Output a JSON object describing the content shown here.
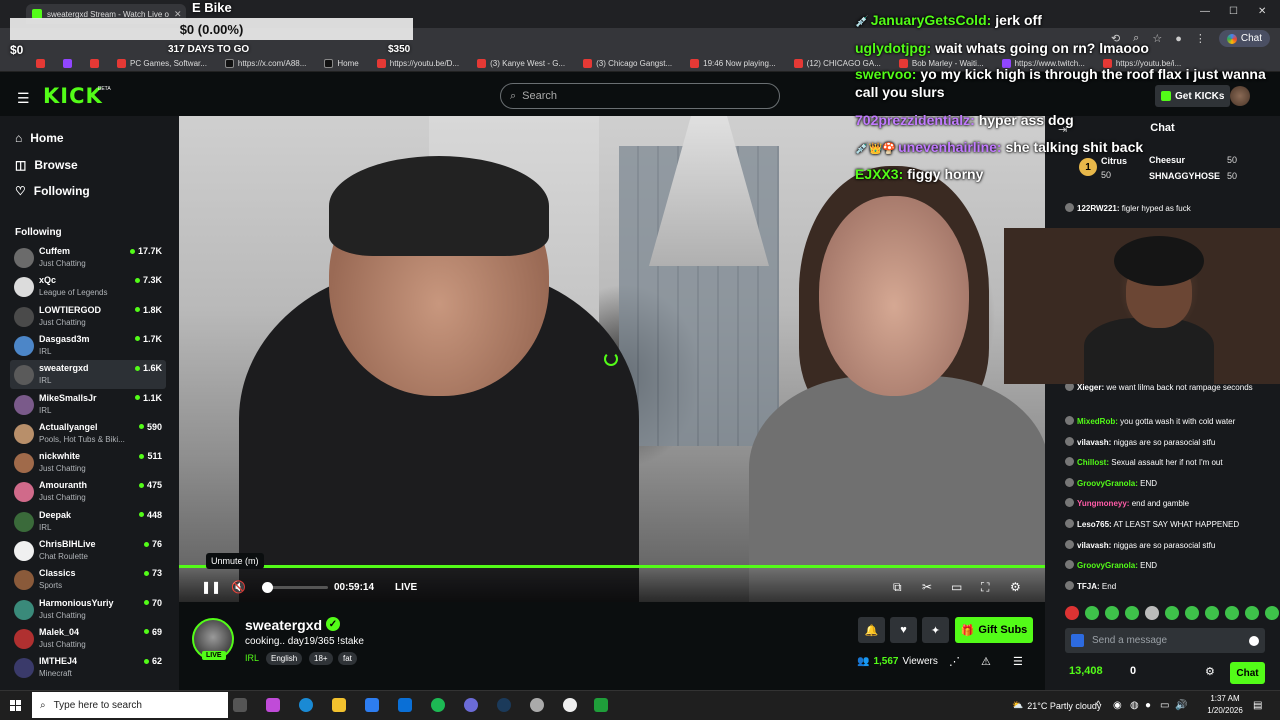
{
  "browser": {
    "tab_title": "sweatergxd Stream - Watch Live o",
    "tab_close": "✕",
    "win_min": "—",
    "win_max": "☐",
    "win_close": "✕",
    "chat_button": "Chat",
    "bookmarks": [
      {
        "label": "",
        "icon": "youtube"
      },
      {
        "label": "",
        "icon": "twitch"
      },
      {
        "label": "",
        "icon": "youtube"
      },
      {
        "label": "PC Games, Softwar...",
        "icon": "youtube"
      },
      {
        "label": "https://x.com/A88...",
        "icon": "x"
      },
      {
        "label": "Home",
        "icon": "x"
      },
      {
        "label": "https://youtu.be/D...",
        "icon": "youtube"
      },
      {
        "label": "(3) Kanye West - G...",
        "icon": "youtube"
      },
      {
        "label": "(3) Chicago Gangst...",
        "icon": "youtube"
      },
      {
        "label": "19:46 Now playing...",
        "icon": "youtube"
      },
      {
        "label": "(12) CHICAGO GA...",
        "icon": "youtube"
      },
      {
        "label": "Bob Marley - Waiti...",
        "icon": "youtube"
      },
      {
        "label": "https://www.twitch...",
        "icon": "twitch"
      },
      {
        "label": "https://youtu.be/i...",
        "icon": "youtube"
      }
    ]
  },
  "goal_overlay": {
    "title": "E Bike",
    "amount": "$0 (0.00%)",
    "min": "$0",
    "days": "317 DAYS TO GO",
    "max": "$350"
  },
  "header": {
    "logo": "KICK",
    "beta": "BETA",
    "search_placeholder": "Search",
    "get_kicks": "Get KICKs"
  },
  "nav": {
    "home": "Home",
    "browse": "Browse",
    "following": "Following",
    "following_header": "Following"
  },
  "channels": [
    {
      "name": "Cuffem",
      "category": "Just Chatting",
      "viewers": "17.7K",
      "color": "#6b6b6b"
    },
    {
      "name": "xQc",
      "category": "League of Legends",
      "viewers": "7.3K",
      "color": "#dcdcdc"
    },
    {
      "name": "LOWTIERGOD",
      "category": "Just Chatting",
      "viewers": "1.8K",
      "color": "#4a4a4a"
    },
    {
      "name": "Dasgasd3m",
      "category": "IRL",
      "viewers": "1.7K",
      "color": "#4c86c8"
    },
    {
      "name": "sweatergxd",
      "category": "IRL",
      "viewers": "1.6K",
      "color": "#5a5a5a"
    },
    {
      "name": "MikeSmallsJr",
      "category": "IRL",
      "viewers": "1.1K",
      "color": "#7a5a8a"
    },
    {
      "name": "Actuallyangel",
      "category": "Pools, Hot Tubs & Biki...",
      "viewers": "590",
      "color": "#b88f6a"
    },
    {
      "name": "nickwhite",
      "category": "Just Chatting",
      "viewers": "511",
      "color": "#a06a4a"
    },
    {
      "name": "Amouranth",
      "category": "Just Chatting",
      "viewers": "475",
      "color": "#d06a8a"
    },
    {
      "name": "Deepak",
      "category": "IRL",
      "viewers": "448",
      "color": "#3a6a3a"
    },
    {
      "name": "ChrisBIHLive",
      "category": "Chat Roulette",
      "viewers": "76",
      "color": "#f0f0f0"
    },
    {
      "name": "Classics",
      "category": "Sports",
      "viewers": "73",
      "color": "#8a5a3a"
    },
    {
      "name": "HarmoniousYuriy",
      "category": "Just Chatting",
      "viewers": "70",
      "color": "#3a8a7a"
    },
    {
      "name": "Malek_04",
      "category": "Just Chatting",
      "viewers": "69",
      "color": "#b03030"
    },
    {
      "name": "IMTHEJ4",
      "category": "Minecraft",
      "viewers": "62",
      "color": "#3a3a6a"
    }
  ],
  "player": {
    "tooltip": "Unmute (m)",
    "time": "00:59:14",
    "live": "LIVE",
    "progress_fraction": 1.0,
    "volume_fraction": 0.0
  },
  "stream": {
    "streamer": "sweatergxd",
    "live_badge": "LIVE",
    "title": "cooking.. day19/365 !stake",
    "category": "IRL",
    "tags": [
      "English",
      "18+",
      "fat"
    ],
    "gift_subs": "Gift Subs",
    "viewers_count": "1,567",
    "viewers_label": "Viewers"
  },
  "chat": {
    "header": "Chat",
    "leaderboard": [
      {
        "name": "Citrus",
        "value": "50",
        "color": "#e8b84a"
      },
      {
        "name": "Cheesur",
        "value": "50",
        "color": "#ffffff"
      },
      {
        "name": "SHNAGGYHOSE",
        "value": "50",
        "color": "#e8b84a"
      }
    ],
    "leader_rank": "1",
    "messages": [
      {
        "user": "122RW221:",
        "text": "figler hyped as fuck",
        "color": "#ffffff"
      },
      {
        "user": "Xieger:",
        "text": "we want lilma back not rampage seconds",
        "color": "#ffffff"
      },
      {
        "user": "MixedRob:",
        "text": "you gotta wash it with cold water",
        "color": "#53fc18"
      },
      {
        "user": "vilavash:",
        "text": "niggas are so parasocial stfu",
        "color": "#ffffff"
      },
      {
        "user": "Chillost:",
        "text": "Sexual assault her if not I'm out",
        "color": "#53fc18"
      },
      {
        "user": "GroovyGranola:",
        "text": "END",
        "color": "#53fc18"
      },
      {
        "user": "Yungmoneyy:",
        "text": "end and gamble",
        "color": "#ff5ca8"
      },
      {
        "user": "Leso765:",
        "text": "AT LEAST SAY WHAT HAPPENED",
        "color": "#ffffff"
      },
      {
        "user": "vilavash:",
        "text": "niggas are so parasocial stfu",
        "color": "#ffffff"
      },
      {
        "user": "GroovyGranola:",
        "text": "END",
        "color": "#53fc18"
      },
      {
        "user": "TFJA:",
        "text": "End",
        "color": "#ffffff"
      }
    ],
    "input_placeholder": "Send a message",
    "kicks_balance": "13,408",
    "points_balance": "0",
    "send_label": "Chat"
  },
  "overlay_chat": [
    {
      "user": "JanuaryGetsCold:",
      "text": "jerk off",
      "color": "#53fc18",
      "badges": "💉"
    },
    {
      "user": "uglydotjpg:",
      "text": "wait whats going on rn? lmaooo",
      "color": "#53fc18",
      "badges": ""
    },
    {
      "user": "swervoo:",
      "text": "yo my kick high is through the roof flax i just wanna",
      "color": "#53fc18",
      "badges": ""
    },
    {
      "user": "",
      "text": "call you slurs",
      "color": "#ffffff",
      "badges": ""
    },
    {
      "user": "702prezzidentialz:",
      "text": "hyper ass dog",
      "color": "#c27bff",
      "badges": ""
    },
    {
      "user": "unevenhairline:",
      "text": "she talking shit back",
      "color": "#c27bff",
      "badges": "💉👑🍄"
    },
    {
      "user": "EJXX3:",
      "text": "figgy horny",
      "color": "#53fc18",
      "badges": ""
    }
  ],
  "taskbar": {
    "search_placeholder": "Type here to search",
    "weather": "21°C  Partly cloudy",
    "time": "1:37 AM",
    "date": "1/20/2026"
  }
}
